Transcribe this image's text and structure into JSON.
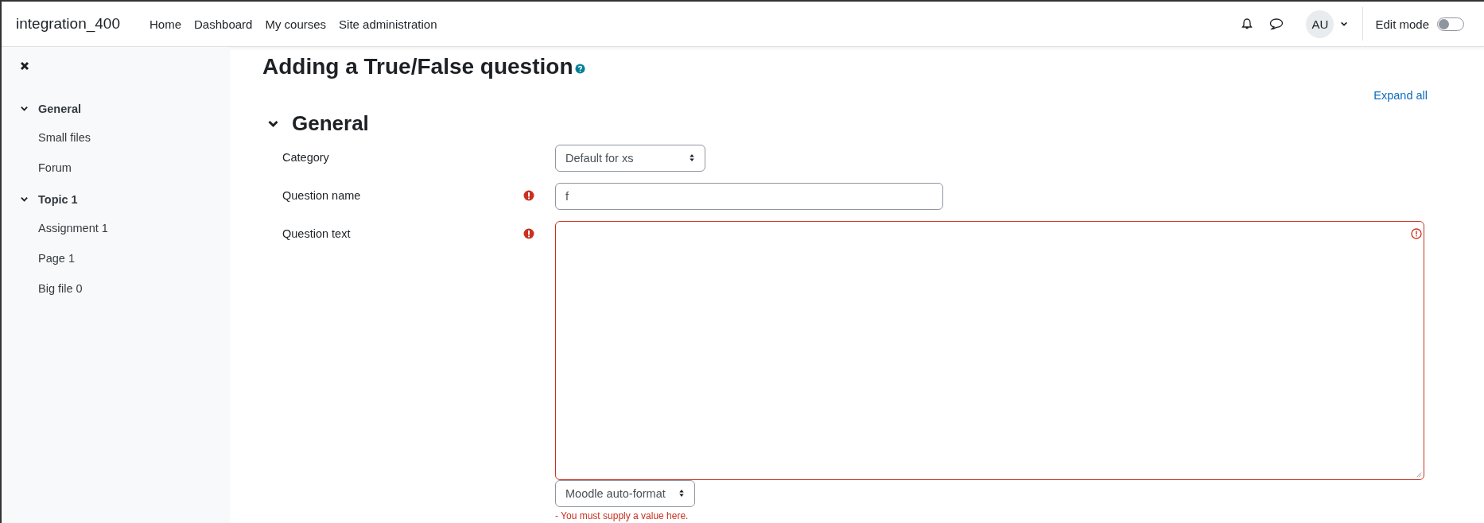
{
  "navbar": {
    "site_name": "integration_400",
    "links": [
      {
        "label": "Home",
        "selected": false
      },
      {
        "label": "Dashboard",
        "selected": false
      },
      {
        "label": "My courses",
        "selected": false
      },
      {
        "label": "Site administration",
        "selected": false
      }
    ],
    "avatar": "AU",
    "edit_mode": {
      "label": "Edit mode",
      "on": false
    }
  },
  "sidebar": {
    "sections": [
      {
        "label": "General",
        "expanded": true,
        "children": [
          {
            "label": "Small files"
          },
          {
            "label": "Forum"
          }
        ]
      },
      {
        "label": "Topic 1",
        "expanded": true,
        "children": [
          {
            "label": "Assignment 1"
          },
          {
            "label": "Page 1"
          },
          {
            "label": "Big file 0"
          }
        ]
      }
    ]
  },
  "page_title": "Adding a True/False question",
  "expand_all": "Expand all",
  "section": {
    "title": "General",
    "expanded": true,
    "fields": [
      {
        "kind": "select",
        "label": "Category",
        "required": false,
        "value": "Default for xs"
      },
      {
        "kind": "text",
        "label": "Question name",
        "required": true,
        "value": "f"
      },
      {
        "kind": "editor",
        "label": "Question text",
        "required": true,
        "invalid": true,
        "format": "Moodle auto-format",
        "error": "- You must supply a value here."
      }
    ]
  }
}
